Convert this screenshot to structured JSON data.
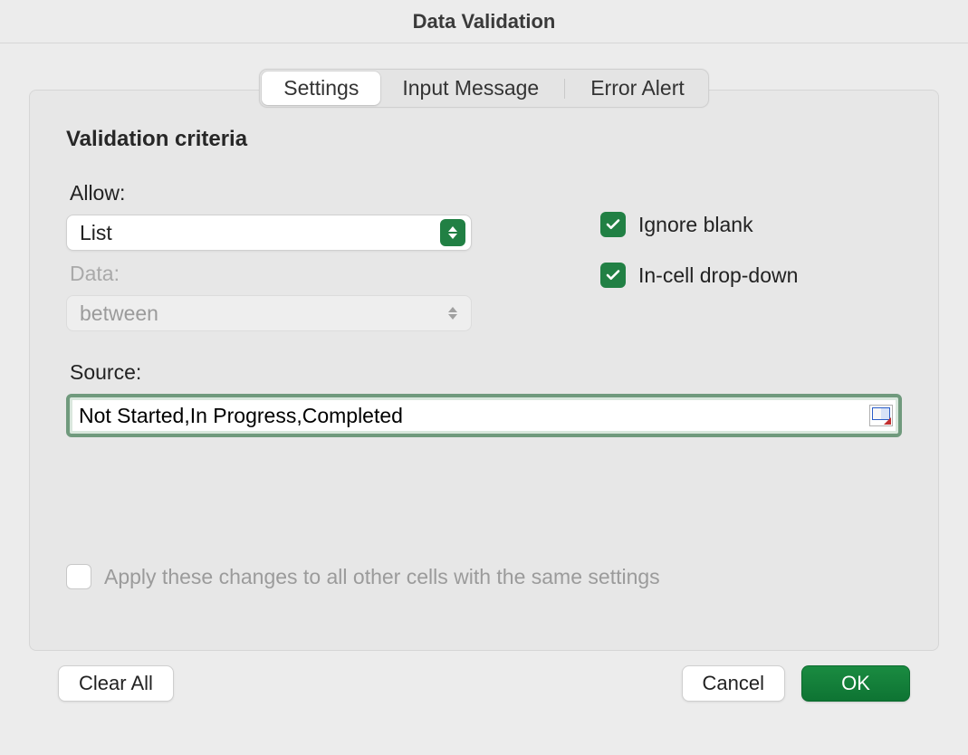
{
  "dialog": {
    "title": "Data Validation"
  },
  "tabs": {
    "settings": "Settings",
    "input_message": "Input Message",
    "error_alert": "Error Alert"
  },
  "criteria": {
    "title": "Validation criteria",
    "allow_label": "Allow:",
    "allow_value": "List",
    "data_label": "Data:",
    "data_value": "between",
    "source_label": "Source:",
    "source_value": "Not Started,In Progress,Completed"
  },
  "options": {
    "ignore_blank": "Ignore blank",
    "in_cell_dropdown": "In-cell drop-down",
    "apply_all": "Apply these changes to all other cells with the same settings"
  },
  "buttons": {
    "clear_all": "Clear All",
    "cancel": "Cancel",
    "ok": "OK"
  },
  "colors": {
    "accent": "#218044"
  }
}
